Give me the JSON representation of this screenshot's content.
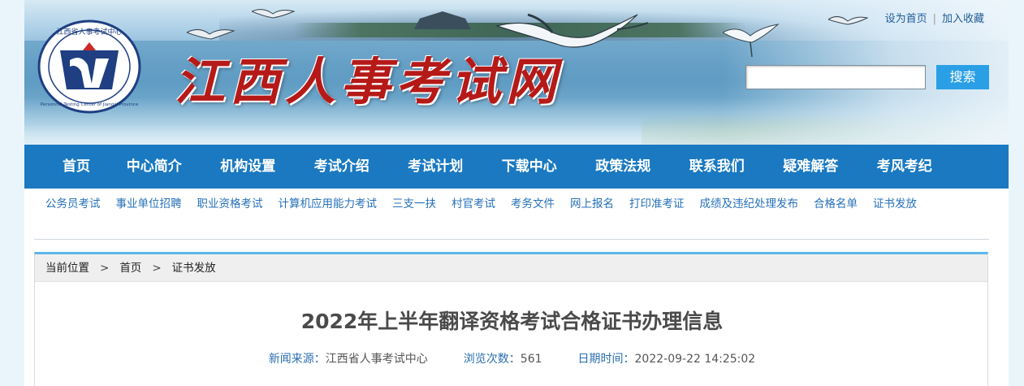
{
  "header": {
    "site_name": "江西人事考试网",
    "logo_icon": "jiangxi-personnel-examination-center-seal",
    "logo_text": "江西省人事考试中心",
    "logo_subtext": "Personnel Testing Center of Jiangxi Province",
    "top_links": {
      "set_home": "设为首页",
      "separator": "|",
      "add_favorite": "加入收藏"
    },
    "search": {
      "placeholder": "",
      "value": "",
      "button_label": "搜索"
    }
  },
  "main_nav": {
    "items": [
      "首页",
      "中心简介",
      "机构设置",
      "考试介绍",
      "考试计划",
      "下载中心",
      "政策法规",
      "联系我们",
      "疑难解答",
      "考风考纪"
    ]
  },
  "sub_nav": {
    "items": [
      "公务员考试",
      "事业单位招聘",
      "职业资格考试",
      "计算机应用能力考试",
      "三支一扶",
      "村官考试",
      "考务文件",
      "网上报名",
      "打印准考证",
      "成绩及违纪处理发布",
      "合格名单",
      "证书发放"
    ]
  },
  "breadcrumb": {
    "label": "当前位置",
    "arrow": ">",
    "items": [
      "首页",
      "证书发放"
    ]
  },
  "article": {
    "title": "2022年上半年翻译资格考试合格证书办理信息",
    "source_label": "新闻来源：",
    "source_value": "江西省人事考试中心",
    "views_label": "浏览次数：",
    "views_value": "561",
    "date_label": "日期时间：",
    "date_value": "2022-09-22 14:25:02"
  },
  "colors": {
    "nav_background": "#1a79c1",
    "search_button": "#2a9fe6",
    "site_name_red": "#b51a18",
    "link_blue": "#2671b8",
    "content_top_border": "#5cb6ea"
  }
}
